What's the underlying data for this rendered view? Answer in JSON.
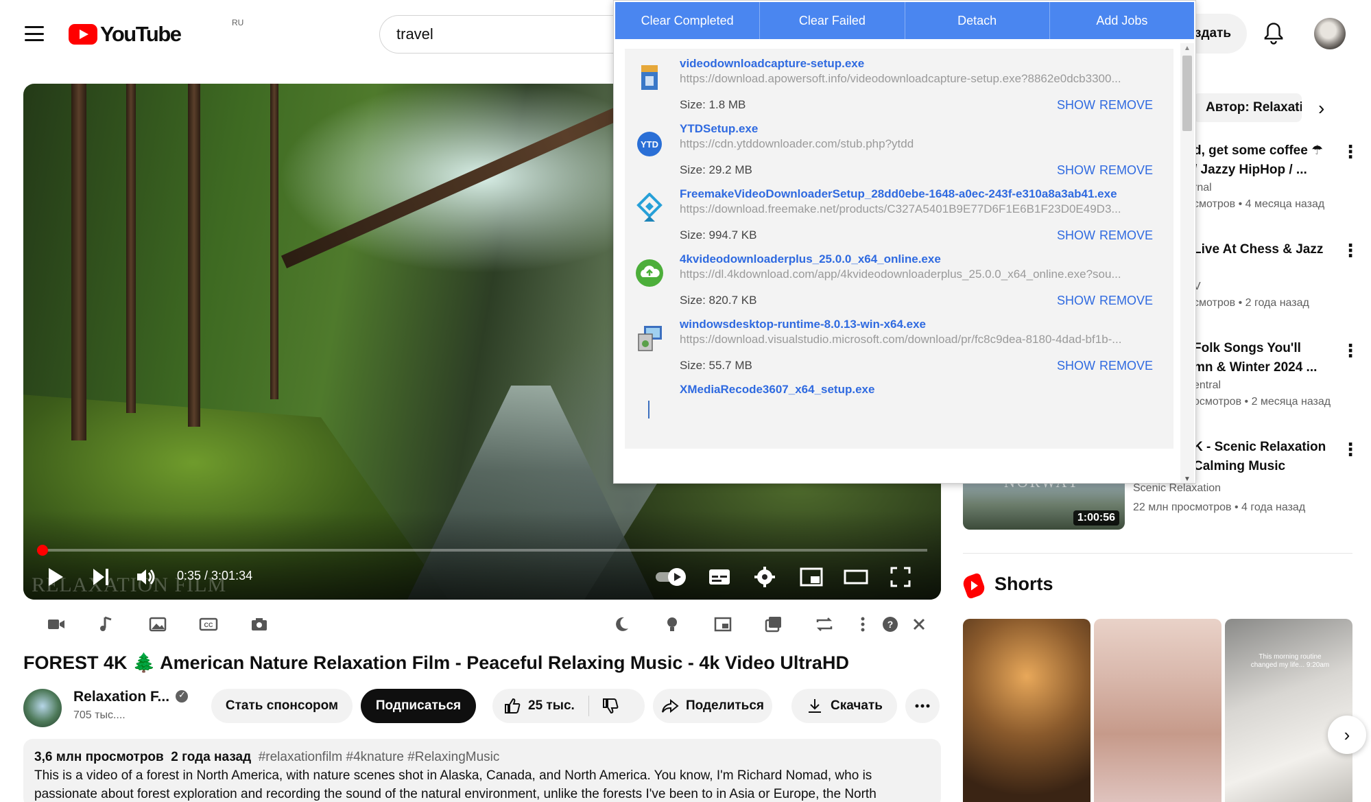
{
  "header": {
    "brand": "YouTube",
    "region": "RU",
    "search_value": "travel",
    "create_label": "здать"
  },
  "player": {
    "time": "0:35 / 3:01:34",
    "progress": 0.0032,
    "watermark": "RELAXATION FILM"
  },
  "video": {
    "title": "FOREST 4K 🌲 American Nature Relaxation Film - Peaceful Relaxing Music - 4k Video UltraHD",
    "channel": "Relaxation F...",
    "subscribers": "705 тыс....",
    "sponsor_label": "Стать спонсором",
    "subscribe_label": "Подписаться",
    "likes": "25 тыс.",
    "share_label": "Поделиться",
    "download_label": "Скачать"
  },
  "description": {
    "views": "3,6 млн просмотров",
    "age": "2 года назад",
    "tags": "#relaxationfilm #4knature #RelaxingMusic",
    "text": "This is a video of a forest in North America, with nature scenes shot in Alaska, Canada, and North America. You know, I'm Richard Nomad, who is passionate about forest exploration and recording the sound of the natural environment, unlike the forests I've been to in Asia or Europe, the North"
  },
  "sidebar": {
    "chip": "Автор: Relaxati",
    "recs": [
      {
        "title1": "d, get some coffee ☂",
        "title2": "/ Jazzy HipHop / ...",
        "channel": "rnal",
        "meta": "смотров • 4 месяца назад"
      },
      {
        "title1": "Live At Chess & Jazz",
        "title2": "",
        "channel": "V",
        "meta": "смотров • 2 года назад"
      },
      {
        "title1": "Folk Songs You'll",
        "title2": "mn & Winter 2024 ...",
        "channel": "entral",
        "meta": "осмотров • 2 месяца назад"
      },
      {
        "title1": "K - Scenic Relaxation",
        "title2": "Calming Music",
        "channel": "Scenic Relaxation",
        "meta": "22 млн просмотров • 4 года назад",
        "duration": "1:00:56",
        "thumb_text": "NORWAY"
      }
    ],
    "shorts_title": "Shorts",
    "shorts": [
      {
        "caption": ""
      },
      {
        "caption": ""
      },
      {
        "caption": "This morning routine changed my life... 9:20am"
      }
    ]
  },
  "download_manager": {
    "tabs": [
      "Clear Completed",
      "Clear Failed",
      "Detach",
      "Add Jobs"
    ],
    "show_label": "SHOW",
    "remove_label": "REMOVE",
    "items": [
      {
        "name": "videodownloadcapture-setup.exe",
        "url": "https://download.apowersoft.info/videodownloadcapture-setup.exe?8862e0dcb3300...",
        "size": "Size: 1.8 MB",
        "icon": "installer-box-icon"
      },
      {
        "name": "YTDSetup.exe",
        "url": "https://cdn.ytddownloader.com/stub.php?ytdd",
        "size": "Size: 29.2 MB",
        "icon": "ytd-logo-icon"
      },
      {
        "name": "FreemakeVideoDownloaderSetup_28dd0ebe-1648-a0ec-243f-e310a8a3ab41.exe",
        "url": "https://download.freemake.net/products/C327A5401B9E77D6F1E6B1F23D0E49D3...",
        "size": "Size: 994.7 KB",
        "icon": "freemake-logo-icon"
      },
      {
        "name": "4kvideodownloaderplus_25.0.0_x64_online.exe",
        "url": "https://dl.4kdownload.com/app/4kvideodownloaderplus_25.0.0_x64_online.exe?sou...",
        "size": "Size: 820.7 KB",
        "icon": "4k-cloud-icon"
      },
      {
        "name": "windowsdesktop-runtime-8.0.13-win-x64.exe",
        "url": "https://download.visualstudio.microsoft.com/download/pr/fc8c9dea-8180-4dad-bf1b-...",
        "size": "Size: 55.7 MB",
        "icon": "installer-computer-icon"
      },
      {
        "name": "XMediaRecode3607_x64_setup.exe",
        "url": "",
        "size": "",
        "icon": "file-icon"
      }
    ]
  }
}
